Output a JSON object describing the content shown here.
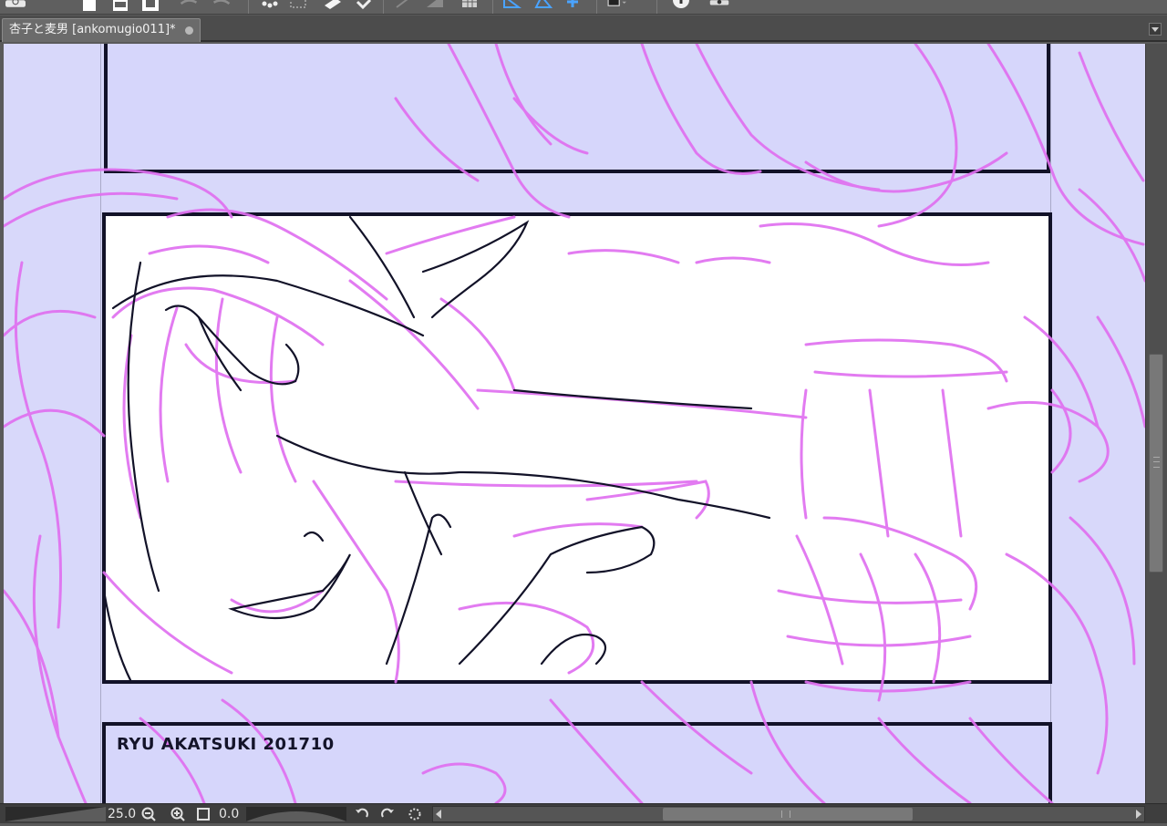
{
  "app": {
    "document_tab": {
      "title": "杏子と麦男 [ankomugio011]*",
      "close_icon": "tab-modified-dot-icon"
    }
  },
  "toolbar": {
    "icons": [
      "app-logo-icon",
      "new-file-icon",
      "open-file-icon",
      "save-icon",
      "undo-icon",
      "redo-icon",
      "sparkle-icon",
      "transform-icon",
      "clear-icon",
      "move-icon",
      "selection-icon",
      "fill-icon",
      "grid-icon",
      "ruler-icon",
      "perspective-icon",
      "snap-icon",
      "color-icon",
      "info-icon",
      "settings-icon"
    ]
  },
  "canvas": {
    "background_color": "#d8d8fa",
    "credit_text": "RYU AKATSUKI 201710",
    "sketch_color": "#e070f0",
    "lineart_color": "#121228"
  },
  "statusbar": {
    "zoom_value": "25.0",
    "rotation_value": "0.0",
    "icons": [
      "zoom-out-icon",
      "zoom-in-icon",
      "fit-screen-icon",
      "rotate-left-icon",
      "rotate-right-icon",
      "reset-rotation-icon"
    ]
  }
}
